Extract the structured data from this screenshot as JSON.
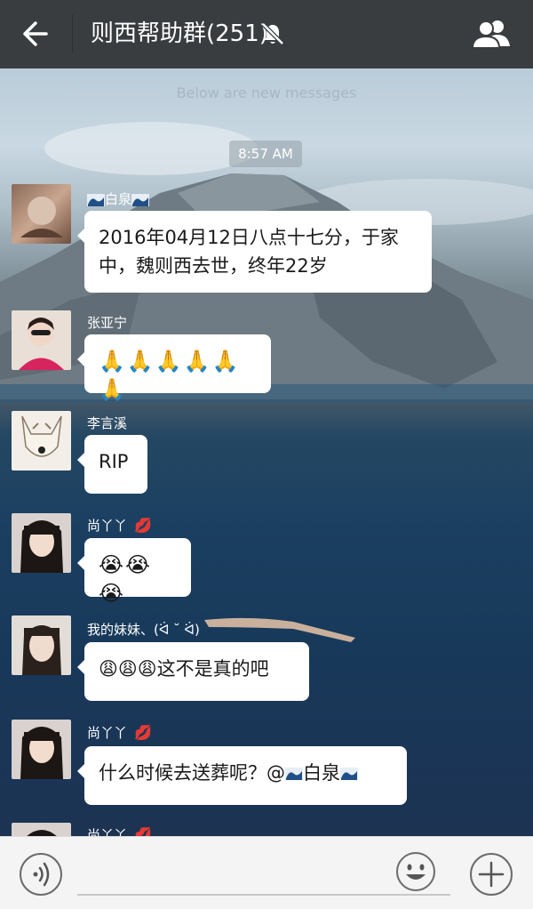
{
  "header": {
    "title": "则西帮助群(251)",
    "back_icon": "arrow-left-icon",
    "mute_icon": "bell-off-icon",
    "members_icon": "group-members-icon"
  },
  "chat": {
    "new_messages_label": "Below are new messages",
    "timestamp": "8:57 AM",
    "messages": [
      {
        "sender": "白泉",
        "text": "2016年04月12日八点十七分，于家中，魏则西去世，终年22岁"
      },
      {
        "sender": "张亚宁",
        "text": "🙏🙏🙏🙏🙏🙏"
      },
      {
        "sender": "李言溪",
        "text": "RIP"
      },
      {
        "sender": "尚丫丫",
        "text": "😭😭😭"
      },
      {
        "sender": "我的妹妹、(ᐛ ˘ ᐛ)",
        "text": "😩😩😩这不是真的吧"
      },
      {
        "sender": "尚丫丫",
        "text_prefix": "什么时候去送葬呢？@",
        "mention": "白泉"
      },
      {
        "sender": "尚丫丫"
      }
    ]
  },
  "input_bar": {
    "voice_icon": "voice-icon",
    "emoji_icon": "smiley-icon",
    "plus_icon": "plus-icon"
  },
  "colors": {
    "topbar": "#3a3d40",
    "bubble": "#ffffff",
    "sender_text": "#ffffff",
    "lips": "#d2203a"
  }
}
